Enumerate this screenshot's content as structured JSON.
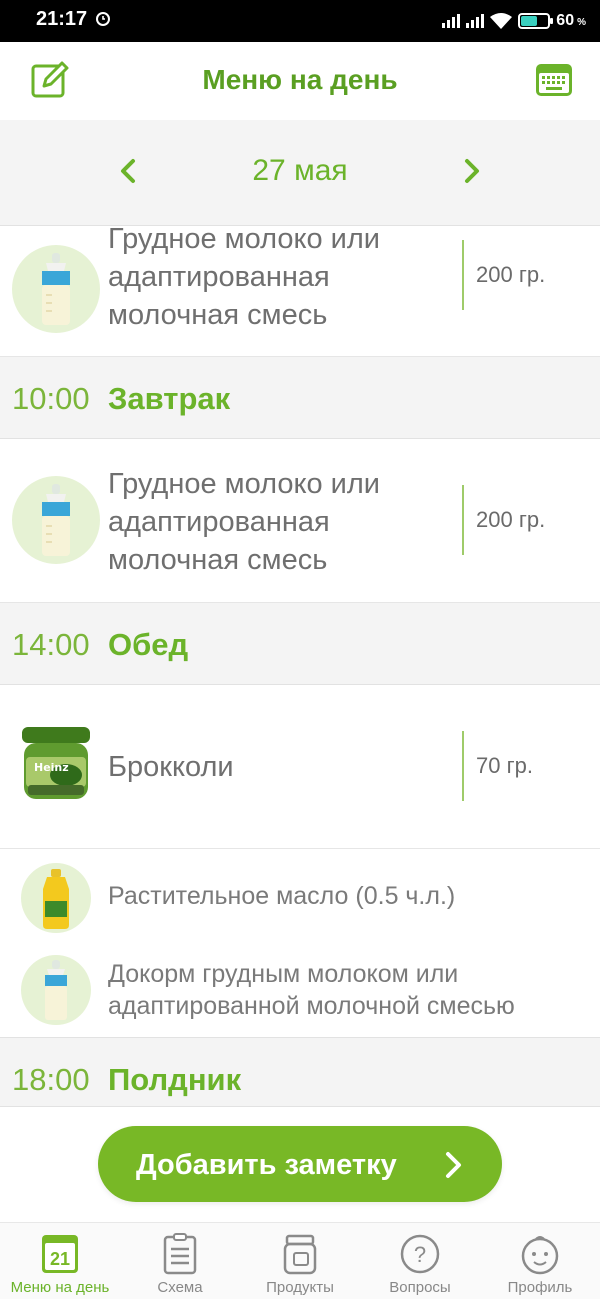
{
  "status_bar": {
    "time": "21:17",
    "battery_percent": "60",
    "battery_unit": "%",
    "battery_level": 0.6
  },
  "header": {
    "title": "Меню на день"
  },
  "date_nav": {
    "date": "27 мая"
  },
  "items": {
    "first": {
      "name": "Грудное молоко или адаптированная молочная смесь",
      "amount": "200 гр."
    },
    "breakfast_item": {
      "name": "Грудное молоко или адаптированная молочная смесь",
      "amount": "200 гр."
    },
    "lunch_item": {
      "name": "Брокколи",
      "amount": "70 гр."
    },
    "oil_item": {
      "name": "Растительное масло (0.5 ч.л.)"
    },
    "supplement_item": {
      "name": "Докорм грудным молоком или адаптированной молочной смесью"
    }
  },
  "meals": {
    "breakfast": {
      "time": "10:00",
      "name": "Завтрак"
    },
    "lunch": {
      "time": "14:00",
      "name": "Обед"
    },
    "snack": {
      "time": "18:00",
      "name": "Полдник"
    }
  },
  "jar_label": "Heinz",
  "add_note": {
    "label": "Добавить заметку"
  },
  "tabs": {
    "today_day_number": "21",
    "menu": "Меню на день",
    "scheme": "Схема",
    "products": "Продукты",
    "questions": "Вопросы",
    "profile": "Профиль"
  },
  "colors": {
    "accent": "#6bb32a",
    "button": "#78b826",
    "section_bg": "#f4f4f4"
  }
}
